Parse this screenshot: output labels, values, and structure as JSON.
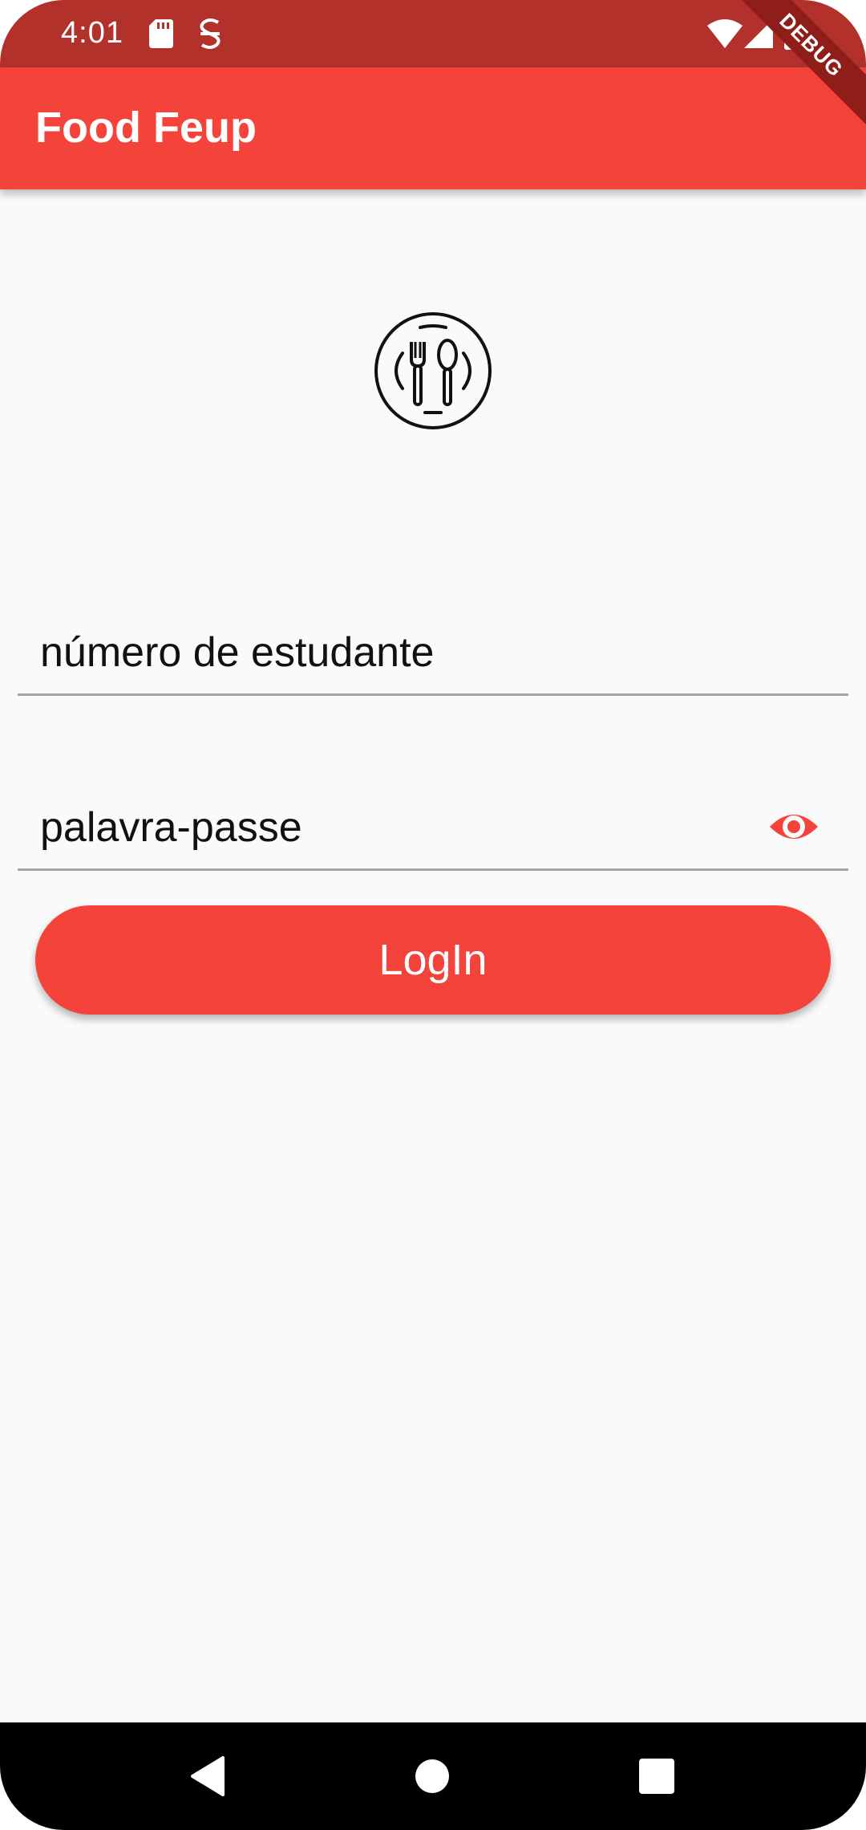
{
  "status_bar": {
    "time": "4:01",
    "icons": [
      "sd-card-icon",
      "notification-icon",
      "wifi-icon",
      "signal-icon",
      "battery-icon"
    ],
    "background": "#b3312b"
  },
  "app_bar": {
    "title": "Food Feup",
    "background": "#f4433b"
  },
  "debug_banner": {
    "label": "DEBUG"
  },
  "logo": {
    "icon": "fork-spoon-plate-icon"
  },
  "form": {
    "student_number": {
      "placeholder": "número de estudante",
      "value": ""
    },
    "password": {
      "placeholder": "palavra-passe",
      "value": "",
      "toggle_icon": "eye-icon"
    },
    "login_label": "LogIn"
  },
  "nav_bar": {
    "icons": [
      "back-icon",
      "home-icon",
      "recents-icon"
    ]
  },
  "colors": {
    "accent": "#f4433b",
    "page_background": "#fafafa",
    "divider": "#a5a5a5"
  }
}
